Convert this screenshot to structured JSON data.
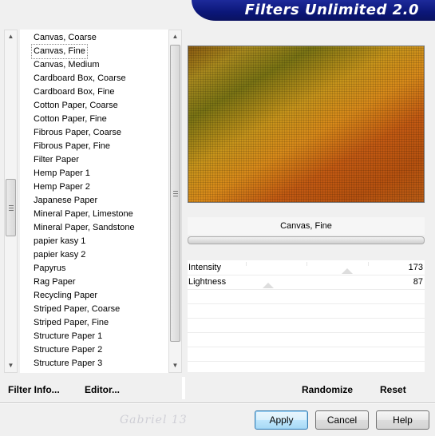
{
  "window": {
    "title": "Filters Unlimited 2.0"
  },
  "filters": {
    "items": [
      "Canvas, Coarse",
      "Canvas, Fine",
      "Canvas, Medium",
      "Cardboard Box, Coarse",
      "Cardboard Box, Fine",
      "Cotton Paper, Coarse",
      "Cotton Paper, Fine",
      "Fibrous Paper, Coarse",
      "Fibrous Paper, Fine",
      "Filter Paper",
      "Hemp Paper 1",
      "Hemp Paper 2",
      "Japanese Paper",
      "Mineral Paper, Limestone",
      "Mineral Paper, Sandstone",
      "papier kasy 1",
      "papier kasy 2",
      "Papyrus",
      "Rag Paper",
      "Recycling Paper",
      "Striped Paper, Coarse",
      "Striped Paper, Fine",
      "Structure Paper 1",
      "Structure Paper 2",
      "Structure Paper 3"
    ],
    "selected_index": 1
  },
  "preview": {
    "current_filter": "Canvas, Fine"
  },
  "params": [
    {
      "label": "Intensity",
      "value": "173"
    },
    {
      "label": "Lightness",
      "value": "87"
    }
  ],
  "bottom": {
    "filter_info": "Filter Info...",
    "editor": "Editor...",
    "randomize": "Randomize",
    "reset": "Reset"
  },
  "buttons": {
    "apply": "Apply",
    "cancel": "Cancel",
    "help": "Help"
  },
  "watermark": "Gabriel 13"
}
